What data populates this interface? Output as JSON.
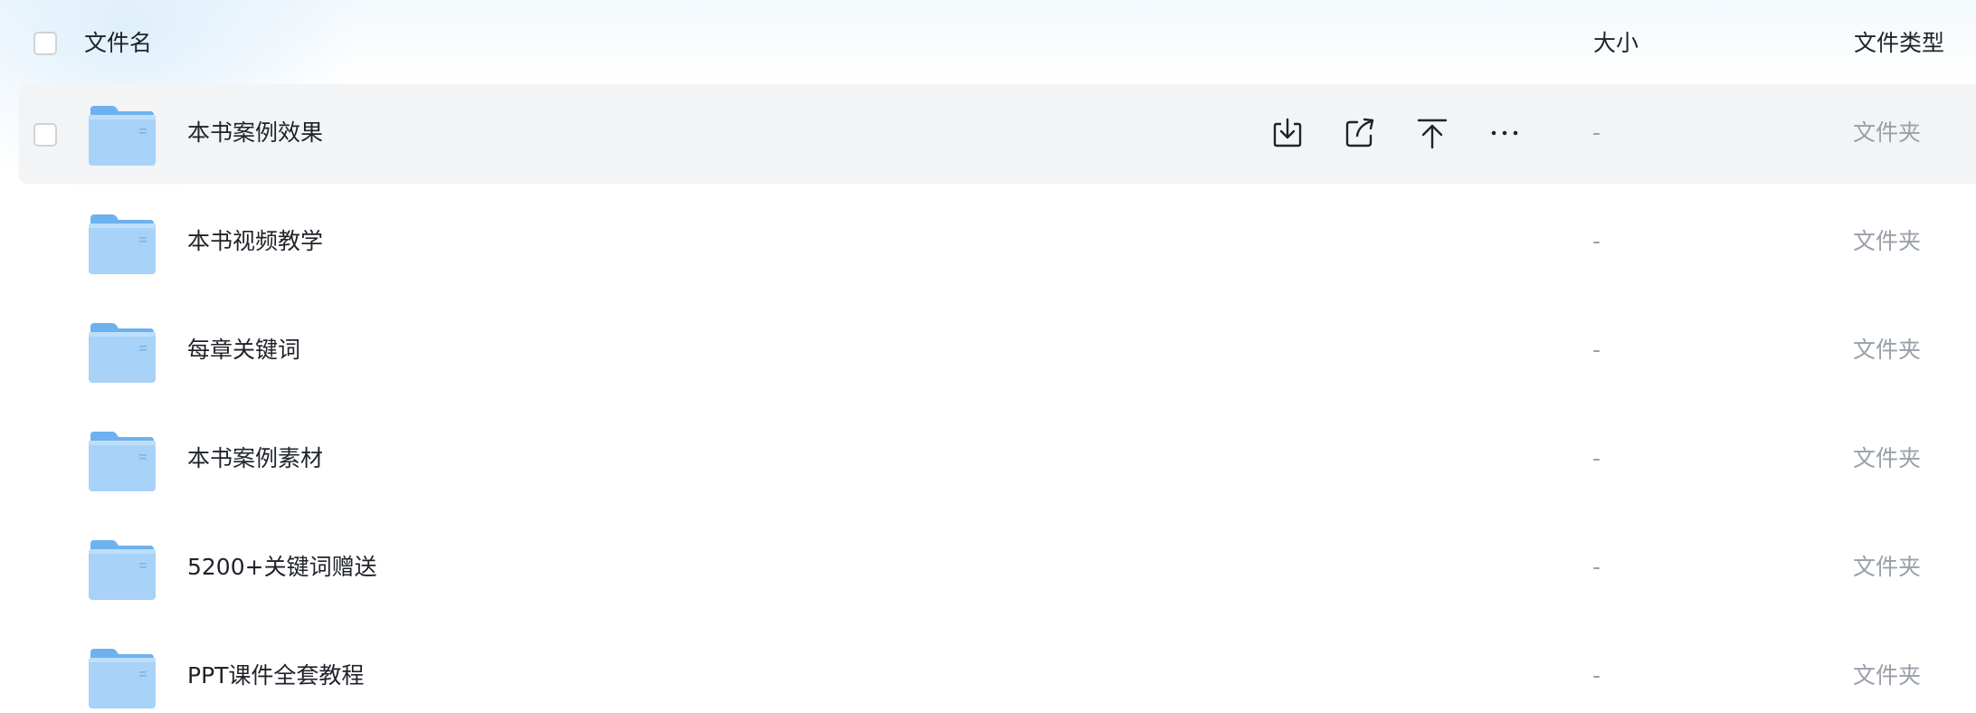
{
  "header": {
    "name_label": "文件名",
    "size_label": "大小",
    "type_label": "文件类型"
  },
  "colors": {
    "folder_blue": "#a8d2f8",
    "folder_tab": "#6db2ef",
    "selected_row_bg": "#f3f4f6",
    "muted_text": "#9aa0a8"
  },
  "row_actions": [
    {
      "icon": "download-icon"
    },
    {
      "icon": "share-icon"
    },
    {
      "icon": "upload-icon"
    },
    {
      "icon": "more-icon"
    }
  ],
  "files": [
    {
      "name": "本书案例效果",
      "size": "-",
      "type": "文件夹",
      "icon": "folder-icon"
    },
    {
      "name": "本书视频教学",
      "size": "-",
      "type": "文件夹",
      "icon": "folder-icon"
    },
    {
      "name": "每章关键词",
      "size": "-",
      "type": "文件夹",
      "icon": "folder-icon"
    },
    {
      "name": "本书案例素材",
      "size": "-",
      "type": "文件夹",
      "icon": "folder-icon"
    },
    {
      "name": "5200+关键词赠送",
      "size": "-",
      "type": "文件夹",
      "icon": "folder-icon"
    },
    {
      "name": "PPT课件全套教程",
      "size": "-",
      "type": "文件夹",
      "icon": "folder-icon"
    }
  ]
}
